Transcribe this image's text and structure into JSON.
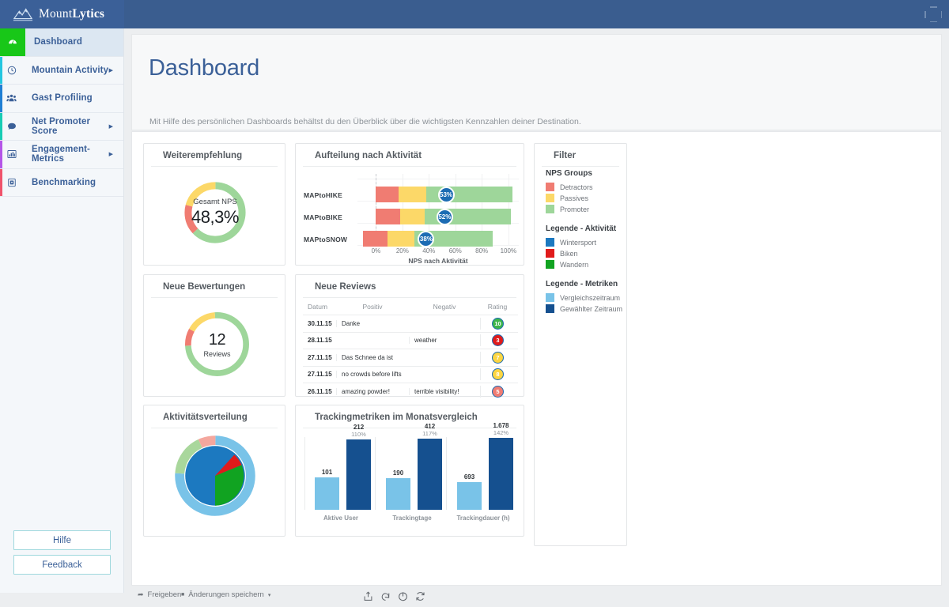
{
  "app": {
    "brand_light": "Mount",
    "brand_bold": "Lytics",
    "topbar_color": "#3a5d8f"
  },
  "sidebar": {
    "items": [
      {
        "label": "Dashboard",
        "icon": "gauge-icon",
        "accent": "#18c718",
        "active": true,
        "caret": false
      },
      {
        "label": "Mountain Activity",
        "icon": "clock-icon",
        "accent": "#24c6e0",
        "active": false,
        "caret": true
      },
      {
        "label": "Gast Profiling",
        "icon": "users-icon",
        "accent": "#1f7fd4",
        "active": false,
        "caret": false
      },
      {
        "label": "Net Promoter Score",
        "icon": "comment-icon",
        "accent": "#17ccb4",
        "active": false,
        "caret": true
      },
      {
        "label": "Engagement-Metrics",
        "icon": "bar-chart-icon",
        "accent": "#b455e8",
        "active": false,
        "caret": true
      },
      {
        "label": "Benchmarking",
        "icon": "shield-icon",
        "accent": "#f0536b",
        "active": false,
        "caret": false
      }
    ],
    "help_label": "Hilfe",
    "feedback_label": "Feedback"
  },
  "header": {
    "title": "Dashboard",
    "subtitle": "Mit Hilfe des persönlichen Dashboards behältst du den Überblick über die wichtigsten Kennzahlen deiner Destination."
  },
  "cards": {
    "recommendation": {
      "title": "Weiterempfehlung",
      "caption": "Gesamt NPS",
      "value": "48,3%"
    },
    "new_ratings": {
      "title": "Neue Bewertungen",
      "value": "12",
      "sub": "Reviews"
    },
    "activity_split": {
      "title": "Aktivitätsverteilung"
    },
    "nps_by_activity": {
      "title": "Aufteilung nach Aktivität"
    },
    "new_reviews": {
      "title": "Neue Reviews"
    },
    "tracking": {
      "title": "Trackingmetriken im Monatsvergleich"
    },
    "filter": {
      "title": "Filter"
    }
  },
  "filter": {
    "groups": [
      {
        "heading": "NPS Groups",
        "entries": [
          {
            "label": "Detractors",
            "color": "#f07c72"
          },
          {
            "label": "Passives",
            "color": "#fcd868"
          },
          {
            "label": "Promoter",
            "color": "#9ed69a"
          }
        ]
      },
      {
        "heading": "Legende - Aktivität",
        "entries": [
          {
            "label": "Wintersport",
            "color": "#1c79c0"
          },
          {
            "label": "Biken",
            "color": "#e01b1b"
          },
          {
            "label": "Wandern",
            "color": "#11a321"
          }
        ]
      },
      {
        "heading": "Legende - Metriken",
        "entries": [
          {
            "label": "Vergleichszeitraum",
            "color": "#79c3e8"
          },
          {
            "label": "Gewählter Zeitraum",
            "color": "#15508f"
          }
        ]
      }
    ]
  },
  "reviews": {
    "columns": [
      "Datum",
      "Positiv",
      "Negativ",
      "Rating"
    ],
    "rows": [
      {
        "date": "30.11.15",
        "positive": "Danke",
        "negative": "",
        "rating": "10",
        "rating_color": "#3cb54a"
      },
      {
        "date": "28.11.15",
        "positive": "",
        "negative": "weather",
        "rating": "3",
        "rating_color": "#e01b1b"
      },
      {
        "date": "27.11.15",
        "positive": "Das Schnee da ist",
        "negative": "",
        "rating": "7",
        "rating_color": "#fcd541"
      },
      {
        "date": "27.11.15",
        "positive": "no crowds before lifts",
        "negative": "",
        "rating": "8",
        "rating_color": "#fcd541"
      },
      {
        "date": "26.11.15",
        "positive": "amazing powder!",
        "negative": "terrible visibility!",
        "rating": "5",
        "rating_color": "#f07c72"
      }
    ]
  },
  "toolbar": {
    "share_label": "Freigeben",
    "save_label": "Änderungen speichern",
    "save_caret": "▾",
    "icons": [
      "export-icon",
      "undo-icon",
      "power-icon",
      "refresh-icon"
    ]
  },
  "chart_data": [
    {
      "type": "pie",
      "name": "recommendation-donut",
      "title": "Weiterempfehlung",
      "center_label": "Gesamt NPS",
      "center_value": "48,3%",
      "categories": [
        "Promoter",
        "Detractors",
        "Passives"
      ],
      "values": [
        63,
        16,
        21
      ],
      "colors": [
        "#9ed69a",
        "#f07c72",
        "#fcd868"
      ],
      "donut": true,
      "legend": "none"
    },
    {
      "type": "pie",
      "name": "new-ratings-donut",
      "title": "Neue Bewertungen",
      "center_value": "12",
      "center_sub": "Reviews",
      "categories": [
        "Promoter",
        "Detractors",
        "Passives"
      ],
      "values": [
        75,
        9,
        16
      ],
      "colors": [
        "#9ed69a",
        "#f07c72",
        "#fcd868"
      ],
      "donut": true,
      "legend": "none"
    },
    {
      "type": "pie",
      "name": "activity-distribution-pie",
      "title": "Aktivitätsverteilung",
      "rings": [
        {
          "name": "Gewählter Zeitraum",
          "categories": [
            "Wintersport",
            "Wandern",
            "Biken"
          ],
          "values": [
            74,
            18,
            8
          ],
          "colors": [
            "#1c79c0",
            "#11a321",
            "#e01b1b"
          ]
        },
        {
          "name": "Vergleichszeitraum",
          "categories": [
            "Wintersport",
            "Wandern",
            "Biken"
          ],
          "values": [
            76,
            17,
            7
          ],
          "colors": [
            "#79c3e8",
            "#a9d79c",
            "#f4a79e"
          ]
        }
      ],
      "legend": "sidebar"
    },
    {
      "type": "bar",
      "name": "nps-by-activity",
      "title": "Aufteilung nach Aktivität",
      "orientation": "horizontal",
      "stacked": true,
      "categories": [
        "MAPtoHIKE",
        "MAPtoBIKE",
        "MAPtoSNOW"
      ],
      "series": [
        {
          "name": "Detractors",
          "color": "#f07c72",
          "starts": [
            0,
            0,
            -10
          ],
          "ends": [
            17,
            18,
            9
          ]
        },
        {
          "name": "Passives",
          "color": "#fcd868",
          "starts": [
            17,
            18,
            9
          ],
          "ends": [
            38,
            37,
            29
          ]
        },
        {
          "name": "Promoter",
          "color": "#9ed69a",
          "starts": [
            38,
            37,
            29
          ],
          "ends": [
            103,
            102,
            88
          ]
        }
      ],
      "badges": [
        "53%",
        "52%",
        "38%"
      ],
      "badge_x": [
        53,
        52,
        38
      ],
      "xlabel": "NPS nach Aktivität",
      "xticks": [
        "0%",
        "20%",
        "40%",
        "60%",
        "80%",
        "100%"
      ],
      "xtick_values": [
        0,
        20,
        40,
        60,
        80,
        100
      ],
      "xlim": [
        -14,
        108
      ],
      "grid": true
    },
    {
      "type": "bar",
      "name": "tracking-metrics",
      "title": "Trackingmetriken im Monatsvergleich",
      "categories": [
        "Aktive User",
        "Trackingtage",
        "Trackingdauer (h)"
      ],
      "series": [
        {
          "name": "Vergleichszeitraum",
          "color": "#79c3e8",
          "values": [
            101,
            190,
            693
          ],
          "labels": [
            "101",
            "190",
            "693"
          ],
          "heights": [
            45,
            43,
            38
          ]
        },
        {
          "name": "Gewählter Zeitraum",
          "color": "#15508f",
          "values": [
            212,
            412,
            1678
          ],
          "labels": [
            "212",
            "412",
            "1.678"
          ],
          "pct": [
            "110%",
            "117%",
            "142%"
          ],
          "heights": [
            97,
            98,
            99
          ]
        }
      ],
      "ylabel": "",
      "grid": false,
      "legend": "sidebar"
    }
  ]
}
